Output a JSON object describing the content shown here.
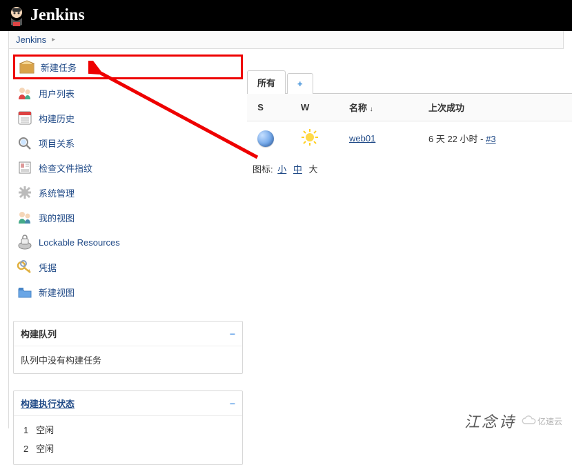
{
  "header": {
    "title": "Jenkins"
  },
  "breadcrumb": {
    "root": "Jenkins"
  },
  "sidebar": {
    "items": [
      {
        "label": "新建任务"
      },
      {
        "label": "用户列表"
      },
      {
        "label": "构建历史"
      },
      {
        "label": "项目关系"
      },
      {
        "label": "检查文件指纹"
      },
      {
        "label": "系统管理"
      },
      {
        "label": "我的视图"
      },
      {
        "label": "Lockable Resources"
      },
      {
        "label": "凭据"
      },
      {
        "label": "新建视图"
      }
    ]
  },
  "buildQueue": {
    "title": "构建队列",
    "empty_text": "队列中没有构建任务"
  },
  "executors": {
    "title": "构建执行状态",
    "rows": [
      {
        "num": "1",
        "state": "空闲"
      },
      {
        "num": "2",
        "state": "空闲"
      }
    ]
  },
  "tabs": {
    "all": "所有",
    "plus": "+"
  },
  "table": {
    "headers": {
      "s": "S",
      "w": "W",
      "name": "名称",
      "last_success": "上次成功"
    },
    "rows": [
      {
        "name": "web01",
        "last_success_text": "6 天 22 小时 -",
        "last_success_link": "#3"
      }
    ]
  },
  "icon_size": {
    "label": "图标:",
    "small": "小",
    "medium": "中",
    "large": "大"
  },
  "watermark": {
    "han": "江念诗",
    "brand": "亿速云"
  }
}
